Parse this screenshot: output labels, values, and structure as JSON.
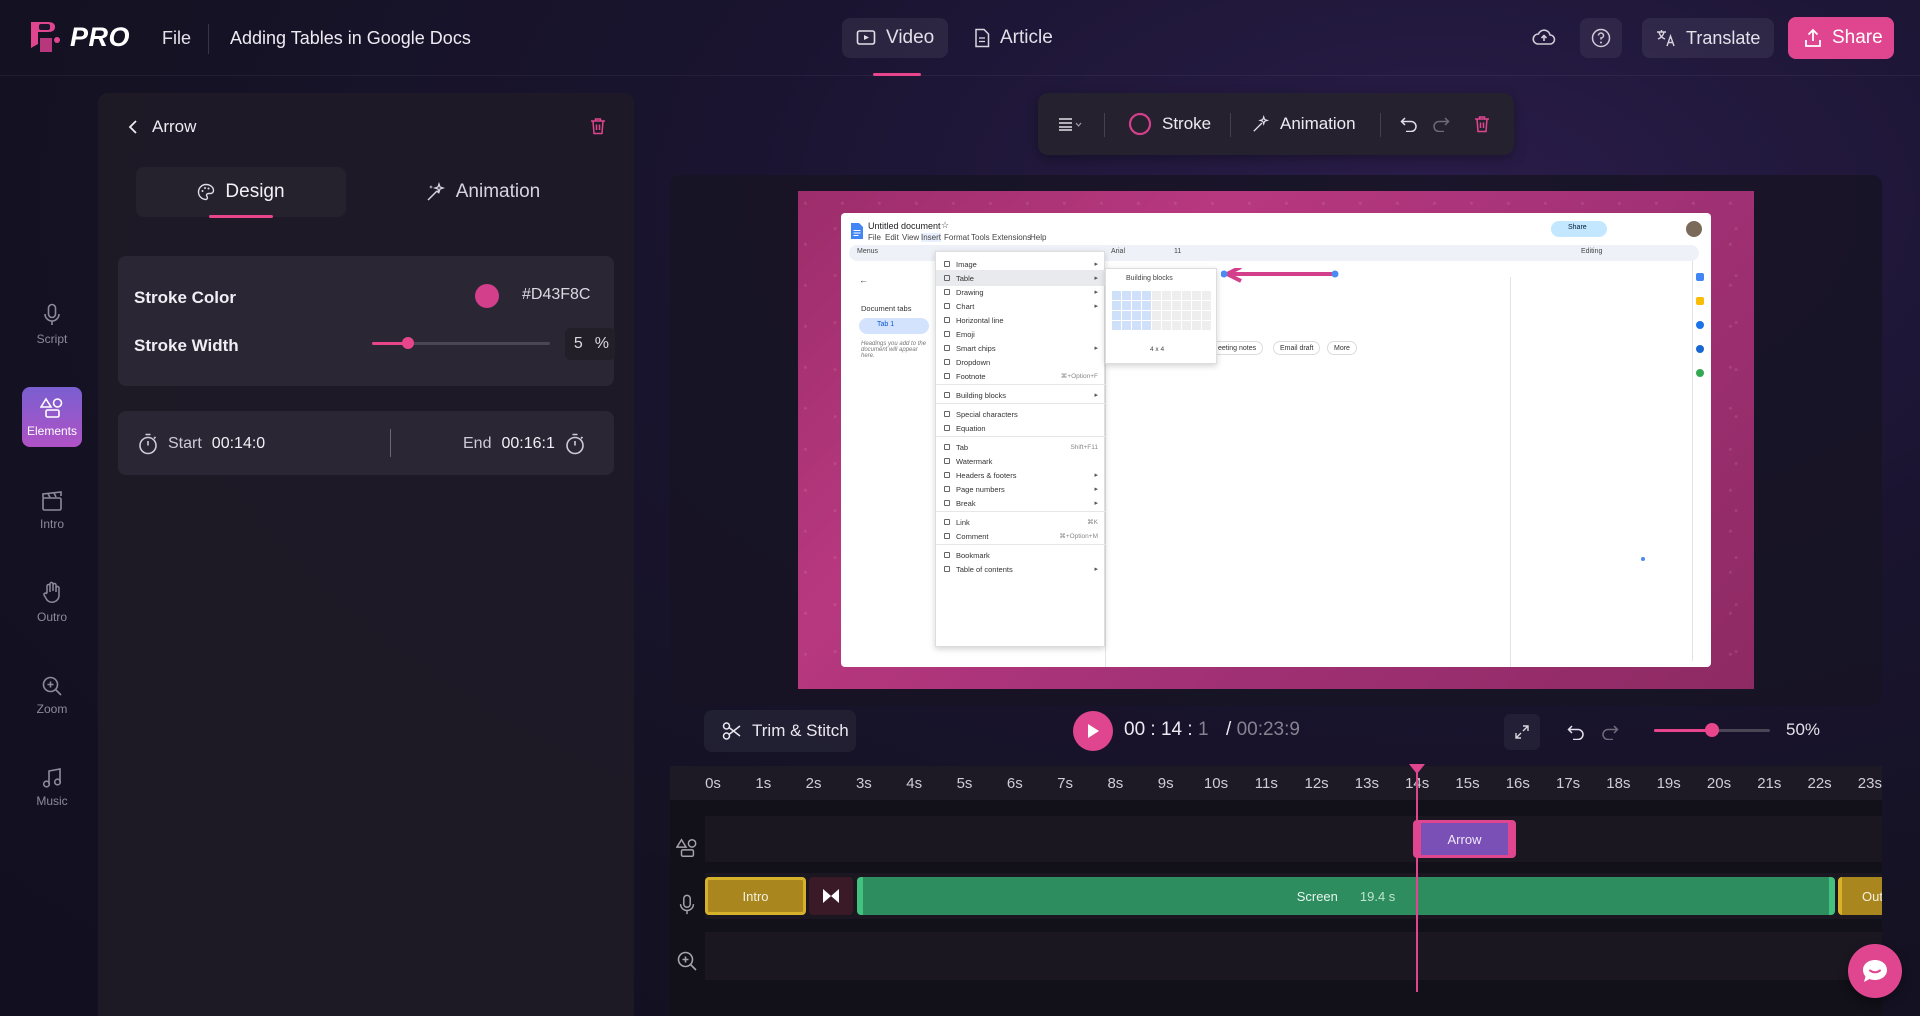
{
  "app": {
    "brand": "PRO",
    "file_menu": "File",
    "doc_title": "Adding Tables in Google Docs"
  },
  "modes": [
    {
      "label": "Video",
      "icon": "video-icon",
      "active": true
    },
    {
      "label": "Article",
      "icon": "article-icon",
      "active": false
    }
  ],
  "header_actions": {
    "translate_label": "Translate",
    "share_label": "Share"
  },
  "nav": [
    {
      "label": "Script",
      "icon": "microphone-icon"
    },
    {
      "label": "Elements",
      "icon": "shapes-icon",
      "active": true
    },
    {
      "label": "Intro",
      "icon": "clapperboard-icon"
    },
    {
      "label": "Outro",
      "icon": "wave-hand-icon"
    },
    {
      "label": "Zoom",
      "icon": "zoom-icon"
    },
    {
      "label": "Music",
      "icon": "music-icon"
    }
  ],
  "panel": {
    "title": "Arrow",
    "tabs": [
      {
        "label": "Design",
        "active": true
      },
      {
        "label": "Animation",
        "active": false
      }
    ],
    "stroke_color_label": "Stroke Color",
    "stroke_color_value": "#D43F8C",
    "stroke_width_label": "Stroke Width",
    "stroke_width_value": "5",
    "stroke_width_unit": "%",
    "stroke_width_level": 0.2,
    "start_label": "Start",
    "start_value": "00:14:0",
    "end_label": "End",
    "end_value": "00:16:1"
  },
  "editor_toolbar": {
    "stroke_label": "Stroke",
    "animation_label": "Animation"
  },
  "gdoc": {
    "doc_name": "Untitled document",
    "menus": [
      "File",
      "Edit",
      "View",
      "Insert",
      "Format",
      "Tools",
      "Extensions",
      "Help"
    ],
    "search_label": "Menus",
    "font": "Arial",
    "font_size": "11",
    "editing": "Editing",
    "share": "Share",
    "doc_tabs_title": "Document tabs",
    "tab1": "Tab 1",
    "outline_hint": "Headings you add to the document will appear here.",
    "insert_menu": [
      {
        "label": "Image",
        "arrow": true
      },
      {
        "label": "Table",
        "arrow": true,
        "hl": true
      },
      {
        "label": "Drawing",
        "arrow": true
      },
      {
        "label": "Chart",
        "arrow": true
      },
      {
        "label": "Horizontal line"
      },
      {
        "label": "Emoji"
      },
      {
        "label": "Smart chips",
        "arrow": true
      },
      {
        "label": "Dropdown"
      },
      {
        "label": "Footnote",
        "shortcut": "⌘+Option+F"
      },
      {
        "sep": true
      },
      {
        "label": "Building blocks",
        "arrow": true
      },
      {
        "sep": true
      },
      {
        "label": "Special characters"
      },
      {
        "label": "Equation"
      },
      {
        "sep": true
      },
      {
        "label": "Tab",
        "shortcut": "Shift+F11"
      },
      {
        "label": "Watermark"
      },
      {
        "label": "Headers & footers",
        "arrow": true
      },
      {
        "label": "Page numbers",
        "arrow": true
      },
      {
        "label": "Break",
        "arrow": true
      },
      {
        "sep": true
      },
      {
        "label": "Link",
        "shortcut": "⌘K"
      },
      {
        "label": "Comment",
        "shortcut": "⌘+Option+M"
      },
      {
        "sep": true
      },
      {
        "label": "Bookmark"
      },
      {
        "label": "Table of contents",
        "arrow": true
      }
    ],
    "submenu_item": "Building blocks",
    "grid_size": "4 x 4",
    "chips": [
      "eeting notes",
      "Email draft",
      "More"
    ]
  },
  "playback": {
    "trim_label": "Trim & Stitch",
    "time_mm": "00",
    "time_ss": "14",
    "time_ff": "1",
    "total": "00:23:9",
    "zoom": "50%",
    "zoom_level": 0.5
  },
  "timeline": {
    "ticks": [
      "0s",
      "1s",
      "2s",
      "3s",
      "4s",
      "5s",
      "6s",
      "7s",
      "8s",
      "9s",
      "10s",
      "11s",
      "12s",
      "13s",
      "14s",
      "15s",
      "16s",
      "17s",
      "18s",
      "19s",
      "20s",
      "21s",
      "22s",
      "23s"
    ],
    "arrow_clip": "Arrow",
    "intro_clip": "Intro",
    "screen_clip": "Screen",
    "screen_duration": "19.4 s",
    "outro_clip": "Outro"
  },
  "colors": {
    "accent": "#E0468F",
    "stroke": "#D43F8C",
    "screen_clip": "#2D8D5F",
    "intro_clip": "#A9861E",
    "arrow_clip": "#7A4FB6"
  }
}
